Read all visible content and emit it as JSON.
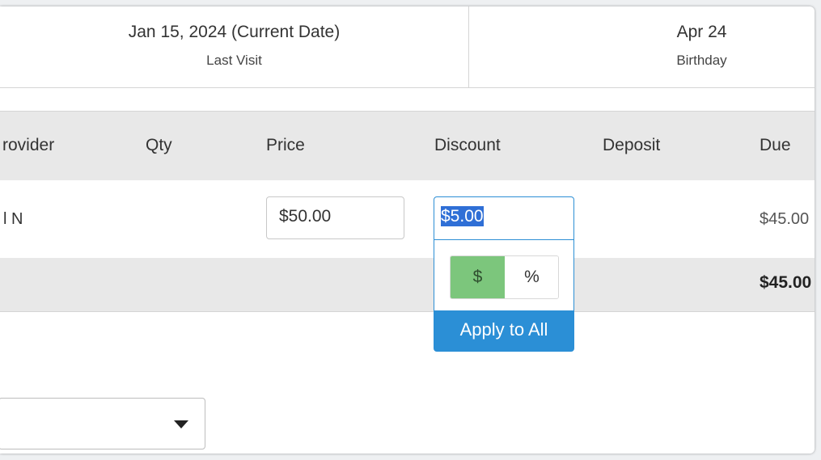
{
  "info": {
    "last_visit": {
      "value": "Jan 15, 2024 (Current Date)",
      "label": "Last Visit"
    },
    "birthday": {
      "value": "Apr 24",
      "label": "Birthday"
    }
  },
  "table": {
    "columns": [
      "rovider",
      "Qty",
      "Price",
      "Discount",
      "Deposit",
      "Due"
    ],
    "row": {
      "provider": "l N",
      "price": "$50.00",
      "discount": "$5.00",
      "due": "$45.00"
    },
    "total_due": "$45.00"
  },
  "discount_popup": {
    "dollar_label": "$",
    "percent_label": "%",
    "selected": "$",
    "apply_label": "Apply to All"
  },
  "colors": {
    "accent": "#2b8fd6",
    "selected_toggle": "#7cc67c",
    "header_bg": "#e8e8e8"
  }
}
